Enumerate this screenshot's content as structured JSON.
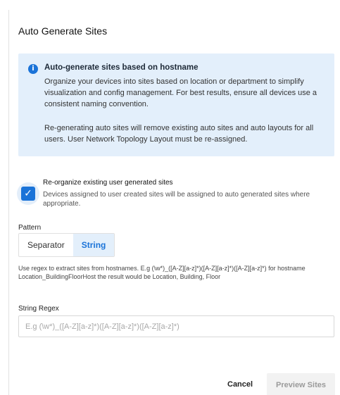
{
  "dialog": {
    "title": "Auto Generate Sites",
    "info": {
      "title": "Auto-generate sites based on hostname",
      "body": "Organize your devices into sites based on location or department to simplify visualization and config management. For best results, ensure all devices use a consistent naming convention.",
      "body2": "Re-generating auto sites will remove existing auto sites and auto layouts for all users. User Network Topology Layout must be re-assigned.",
      "icon": "info-icon"
    },
    "reorganize": {
      "checked": true,
      "title": "Re-organize existing user generated sites",
      "description": "Devices assigned to user created sites will be assigned to auto generated sites where appropriate."
    },
    "pattern": {
      "label": "Pattern",
      "options": [
        "Separator",
        "String"
      ],
      "selected": "String"
    },
    "help_text": "Use regex to extract sites from hostnames. E.g (\\w*)_([A-Z][a-z]*)([A-Z][a-z]*)([A-Z][a-z]*) for hostname Location_BuildingFloorHost the result would be Location, Building, Floor",
    "string_regex": {
      "label": "String Regex",
      "value": "",
      "placeholder": "E.g (\\w*)_([A-Z][a-z]*)([A-Z][a-z]*)([A-Z][a-z]*)"
    },
    "actions": {
      "cancel": "Cancel",
      "preview": "Preview Sites"
    }
  }
}
